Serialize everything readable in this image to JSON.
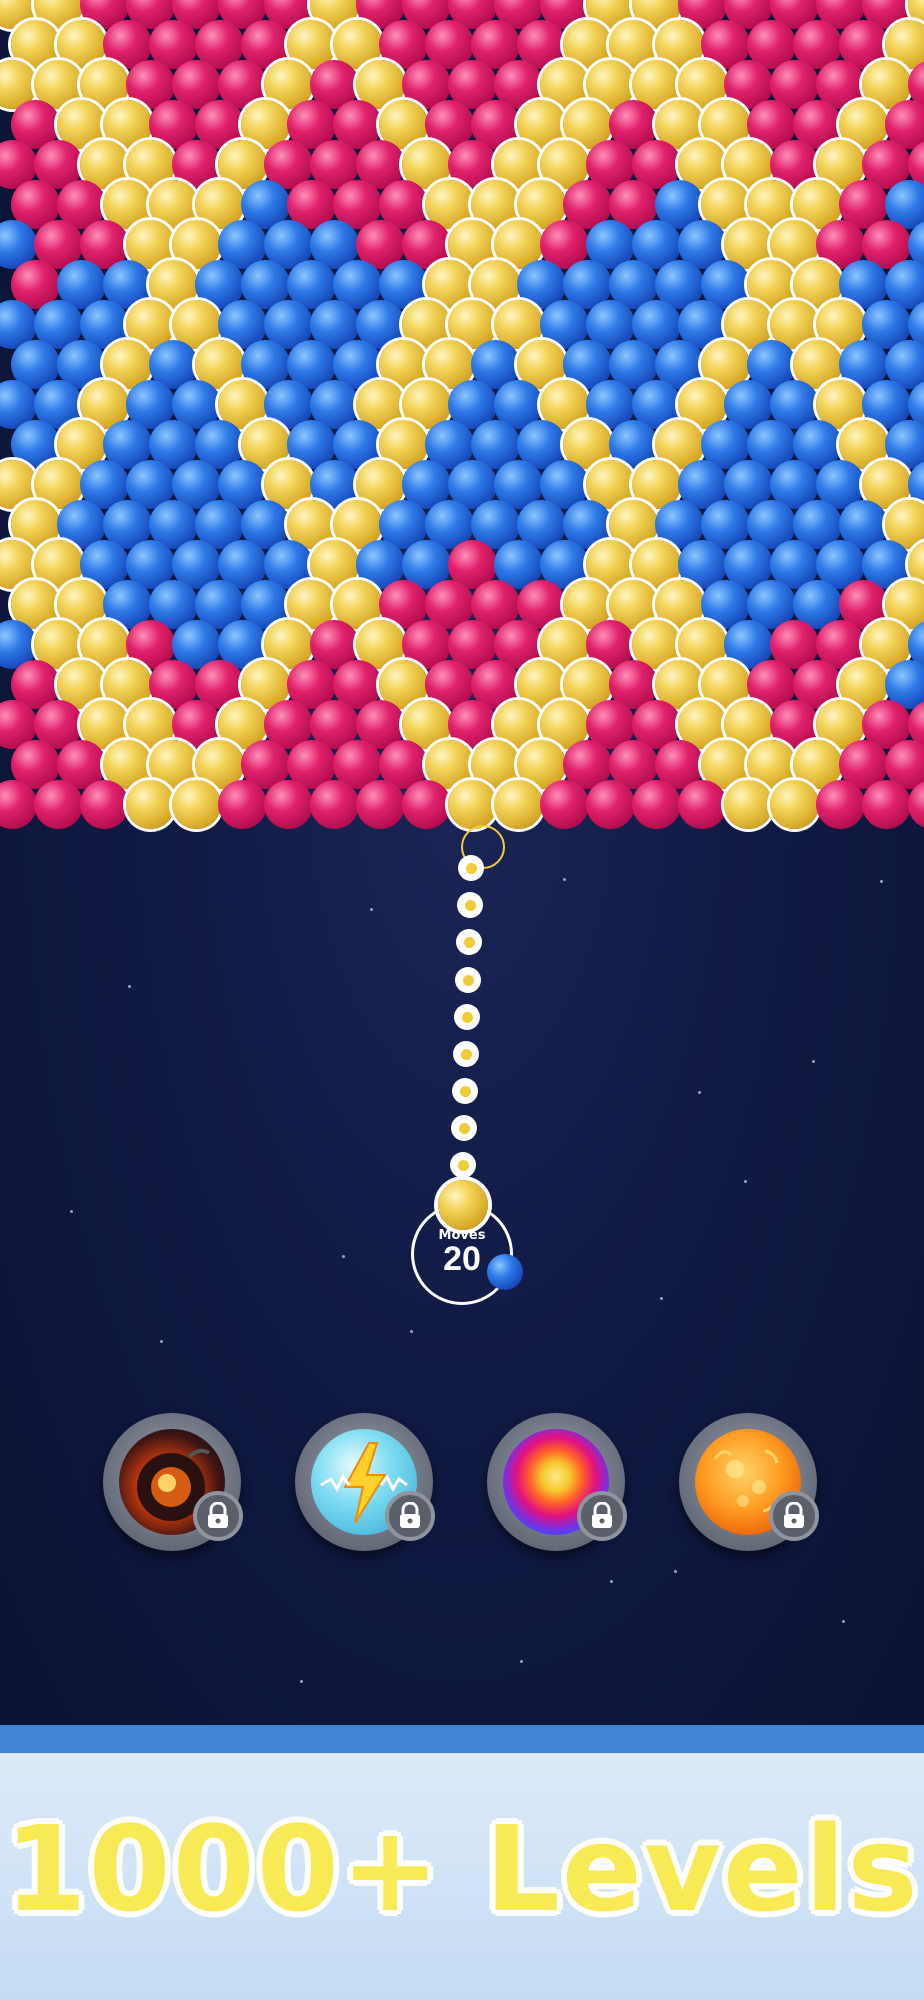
{
  "game": {
    "moves_label": "Moves",
    "moves_value": "20",
    "loaded_bubble_color": "yellow",
    "next_bubble_color": "blue"
  },
  "colors": {
    "yellow": "#f3d45a",
    "pink": "#e0216b",
    "blue": "#2f7ae8",
    "background": "#111a44",
    "footer_stripe": "#3f85d3",
    "title_fill": "#f7ea55"
  },
  "boosters": [
    {
      "name": "bomb",
      "icon": "bomb-icon",
      "locked": true
    },
    {
      "name": "lightning",
      "icon": "lightning-bolt-icon",
      "locked": true
    },
    {
      "name": "rainbow",
      "icon": "rainbow-ball-icon",
      "locked": true
    },
    {
      "name": "fireball",
      "icon": "fireball-icon",
      "locked": true
    }
  ],
  "footer": {
    "title": "1000+ Levels"
  }
}
